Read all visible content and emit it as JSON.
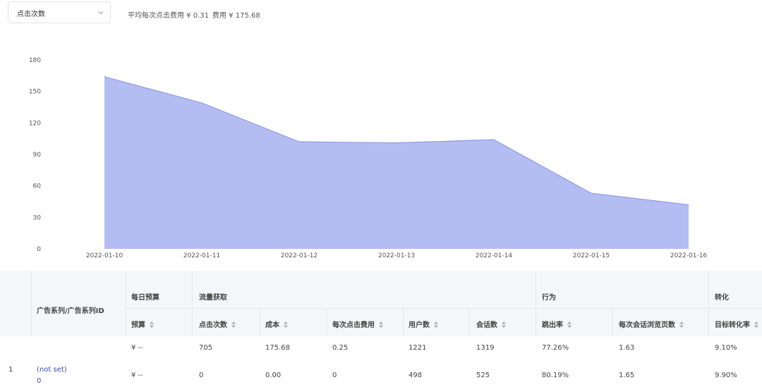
{
  "topbar": {
    "metric_selected": "点击次数",
    "avg_cpc": "平均每次点击费用 ¥ 0.31",
    "cost": "费用 ¥ 175.68"
  },
  "chart_data": {
    "type": "area",
    "x": [
      "2022-01-10",
      "2022-01-11",
      "2022-01-12",
      "2022-01-13",
      "2022-01-14",
      "2022-01-15",
      "2022-01-16"
    ],
    "values": [
      164,
      139,
      102,
      101,
      104,
      53,
      42
    ],
    "yticks": [
      0,
      30,
      60,
      90,
      120,
      150,
      180
    ],
    "ylim": [
      0,
      180
    ],
    "fill_color": "#b4bdf2",
    "line_color": "#8f9be6",
    "grid": false
  },
  "table": {
    "group_headers": {
      "campaign": "广告系列/广告系列ID",
      "budget": "每日预算",
      "traffic": "流量获取",
      "behavior": "行为",
      "conversion": "转化"
    },
    "columns": [
      "预算",
      "点击次数",
      "成本",
      "每次点击费用",
      "用户数",
      "会话数",
      "跳出率",
      "每次会话浏览页数",
      "目标转化率"
    ],
    "total_row": [
      "¥ --",
      "705",
      "175.68",
      "0.25",
      "1221",
      "1319",
      "77.26%",
      "1.63",
      "9.10%"
    ],
    "rows": [
      {
        "index": "1",
        "name": "(not set)",
        "id": "0",
        "values": [
          "¥ --",
          "0",
          "0.00",
          "0",
          "498",
          "525",
          "80.19%",
          "1.65",
          "9.90%"
        ]
      }
    ]
  }
}
